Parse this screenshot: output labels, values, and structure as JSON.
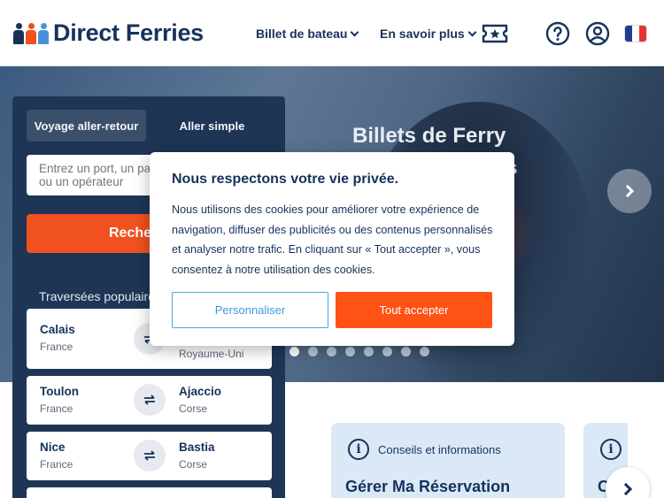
{
  "header": {
    "logo_text": "Direct Ferries",
    "nav": {
      "billet_label": "Billet de bateau",
      "savoir_label": "En savoir plus"
    }
  },
  "hero": {
    "title": "Billets de Ferry",
    "sub_line1": "es",
    "sub_line2": "e"
  },
  "search": {
    "tab_return": "Voyage aller-retour",
    "tab_oneway": "Aller simple",
    "port_placeholder": "Entrez un port, un pays ou un opérateur",
    "search_button": "Reche",
    "popular_title": "Traversées populaires",
    "routes": [
      {
        "from_city": "Calais",
        "from_country": "France",
        "to_city": "",
        "to_country": "Royaume-Uni"
      },
      {
        "from_city": "Toulon",
        "from_country": "France",
        "to_city": "Ajaccio",
        "to_country": "Corse"
      },
      {
        "from_city": "Nice",
        "from_country": "France",
        "to_city": "Bastia",
        "to_country": "Corse"
      }
    ]
  },
  "info": {
    "card_label": "Conseils et informations",
    "card_heading": "Gérer Ma Réservation",
    "card2_heading": "C"
  },
  "cookie": {
    "title": "Nous respectons votre vie privée.",
    "text": "Nous utilisons des cookies pour améliorer votre expérience de navigation, diffuser des publicités ou des contenus personnalisés et analyser notre trafic. En cliquant sur « Tout accepter », vous consentez à notre utilisation des cookies.",
    "customize_button": "Personnaliser",
    "accept_button": "Tout accepter"
  },
  "carousel": {
    "dot_count": 8,
    "active_index": 0
  },
  "colors": {
    "brand_navy": "#16325c",
    "accent_orange": "#ff5316",
    "panel_bg": "#1e3556",
    "link_blue": "#3d9ad9"
  },
  "icons": [
    "help-icon",
    "account-icon",
    "ticket-icon",
    "french-flag-icon",
    "info-icon",
    "swap-icon",
    "chevron-right-icon"
  ]
}
